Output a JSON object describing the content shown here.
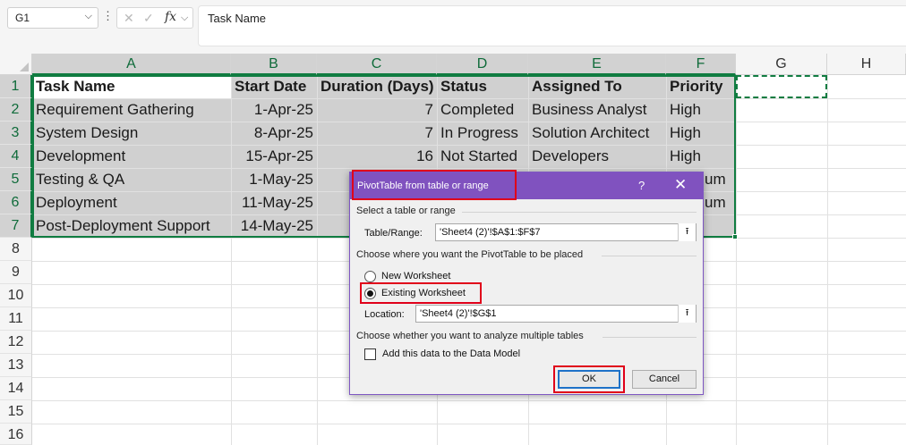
{
  "formula_bar": {
    "name_box": "G1",
    "name_box_arrow": "⌵",
    "dots": "⋮",
    "cancel_icon": "✕",
    "enter_icon": "✓",
    "fx_label": "fx",
    "fx_arrow": "⌵",
    "formula": "Task Name"
  },
  "columns": [
    "A",
    "B",
    "C",
    "D",
    "E",
    "F",
    "G",
    "H"
  ],
  "rows": [
    "1",
    "2",
    "3",
    "4",
    "5",
    "6",
    "7",
    "8",
    "9",
    "10",
    "11",
    "12",
    "13",
    "14",
    "15",
    "16"
  ],
  "sheet": {
    "headers": [
      "Task Name",
      "Start Date",
      "Duration (Days)",
      "Status",
      "Assigned To",
      "Priority"
    ],
    "data": [
      [
        "Requirement Gathering",
        "1-Apr-25",
        "7",
        "Completed",
        "Business Analyst",
        "High"
      ],
      [
        "System Design",
        "8-Apr-25",
        "7",
        "In Progress",
        "Solution Architect",
        "High"
      ],
      [
        "Development",
        "15-Apr-25",
        "16",
        "Not Started",
        "Developers",
        "High"
      ],
      [
        "Testing & QA",
        "1-May-25",
        "",
        "",
        "",
        "um"
      ],
      [
        "Deployment",
        "11-May-25",
        "",
        "",
        "",
        "um"
      ],
      [
        "Post-Deployment Support",
        "14-May-25",
        "",
        "",
        "",
        ""
      ]
    ]
  },
  "dialog": {
    "title": "PivotTable from table or range",
    "help": "?",
    "close": "✕",
    "section_select": "Select a table or range",
    "table_range_label": "Table/Range:",
    "table_range_value": "'Sheet4 (2)'!$A$1:$F$7",
    "section_place": "Choose where you want the PivotTable to be placed",
    "new_worksheet": "New Worksheet",
    "existing_worksheet": "Existing Worksheet",
    "placement": "existing",
    "location_label": "Location:",
    "location_value": "'Sheet4 (2)'!$G$1",
    "collapse_icon": "⭱",
    "section_multi": "Choose whether you want to analyze multiple tables",
    "data_model_label": "Add this data to the Data Model",
    "data_model_checked": false,
    "ok": "OK",
    "cancel": "Cancel"
  },
  "colors": {
    "dialog_title_bg": "#8052bf",
    "selection_border": "#107c41",
    "highlight": "#e0001a",
    "ok_border": "#1e72c8"
  }
}
